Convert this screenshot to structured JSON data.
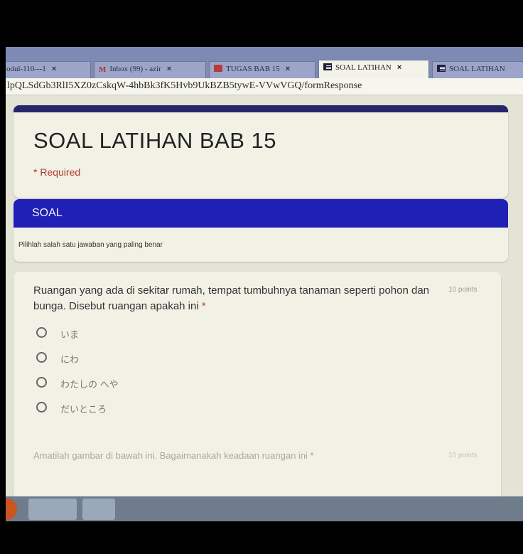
{
  "browser": {
    "tabs": [
      {
        "label": "odul-110---1",
        "icon": "document-icon"
      },
      {
        "label": "Inbox (99) - azir",
        "icon": "gmail-icon"
      },
      {
        "label": "TUGAS BAB 15",
        "icon": "slides-icon"
      },
      {
        "label": "SOAL LATIHAN",
        "icon": "forms-icon",
        "active": true
      },
      {
        "label": "SOAL LATIHAN",
        "icon": "forms-icon"
      }
    ],
    "close_glyph": "×",
    "url": "lpQLSdGb3RlI5XZ0zCskqW-4hbBk3fK5Hvb9UkBZB5tywE-VVwVGQ/formResponse"
  },
  "form": {
    "title": "SOAL LATIHAN BAB 15",
    "required_note": "* Required",
    "section_title": "SOAL",
    "section_description": "Pilihlah salah satu jawaban yang paling benar",
    "question1": {
      "text": "Ruangan yang ada di sekitar rumah, tempat tumbuhnya tanaman seperti pohon dan bunga. Disebut ruangan apakah ini",
      "required_mark": "*",
      "points": "10 points",
      "options": [
        "いま",
        "にわ",
        "わたしの へや",
        "だいところ"
      ]
    },
    "question2": {
      "text": "Amatilah gambar di bawah ini. Bagaimanakah keadaan ruangan ini",
      "required_mark": "*",
      "points": "10 points"
    }
  },
  "colors": {
    "header_accent": "#27266a",
    "section_blue": "#2020b6",
    "required_red": "#b33a2a"
  }
}
